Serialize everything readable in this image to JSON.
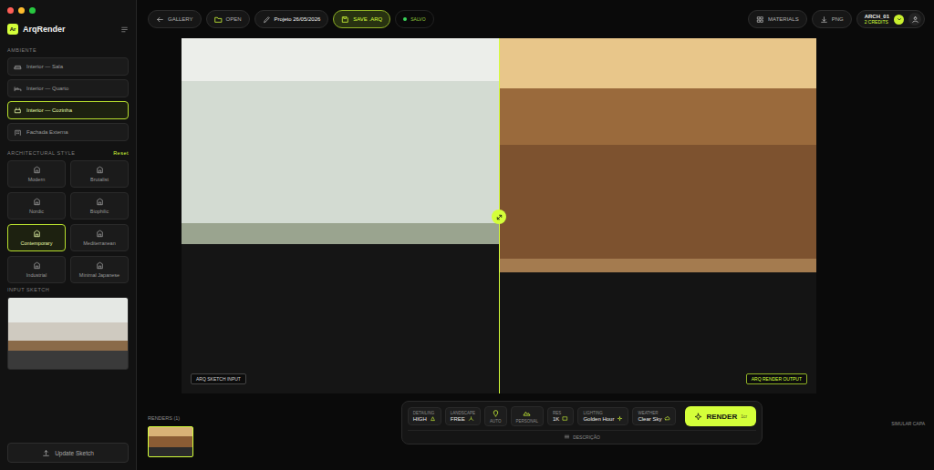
{
  "app": {
    "logo_mark": "Ar",
    "name": "ArqRender"
  },
  "sidebar": {
    "ambient_title": "AMBIENTE",
    "ambients": [
      {
        "label": "Interior — Sala",
        "selected": false
      },
      {
        "label": "Interior — Quarto",
        "selected": false
      },
      {
        "label": "Interior — Cozinha",
        "selected": true
      },
      {
        "label": "Fachada Externa",
        "selected": false
      }
    ],
    "style_title": "ARCHITECTURAL STYLE",
    "style_reset": "Reset",
    "styles": [
      {
        "label": "Modern",
        "selected": false
      },
      {
        "label": "Brutalist",
        "selected": false
      },
      {
        "label": "Nordic",
        "selected": false
      },
      {
        "label": "Biophilic",
        "selected": false
      },
      {
        "label": "Contemporary",
        "selected": true
      },
      {
        "label": "Mediterranean",
        "selected": false
      },
      {
        "label": "Industrial",
        "selected": false
      },
      {
        "label": "Minimal Japanese",
        "selected": false
      }
    ],
    "sketch_title": "INPUT SKETCH",
    "update_button": "Update Sketch"
  },
  "topbar": {
    "gallery": "GALLERY",
    "open": "OPEN",
    "project": "Projeto 26/05/2026",
    "save": "SAVE .ARQ",
    "status": "SALVO",
    "materials": "MATERIALS",
    "export": "PNG",
    "user": "ARCH_01",
    "credits": "2 CREDITS"
  },
  "canvas": {
    "split": 0.5,
    "input_label": "ARQ SKETCH INPUT",
    "output_label": "ARQ RENDER OUTPUT"
  },
  "renders": {
    "title": "RENDERS (1)",
    "items": [
      {
        "selected": true
      }
    ]
  },
  "controls": [
    {
      "kind": "field",
      "label": "DETAILING",
      "value": "HIGH"
    },
    {
      "kind": "field",
      "label": "LANDSCAPE",
      "value": "FREE"
    },
    {
      "kind": "icon",
      "label": "",
      "value": "AUTO"
    },
    {
      "kind": "icon",
      "label": "",
      "value": "PERSONAL"
    },
    {
      "kind": "field",
      "label": "RES",
      "value": "1K"
    },
    {
      "kind": "field",
      "label": "LIGHTING",
      "value": "Golden Hour"
    },
    {
      "kind": "field",
      "label": "WEATHER",
      "value": "Clear Sky"
    }
  ],
  "render_button": {
    "label": "RENDER",
    "cost": "1cr"
  },
  "description": "DESCRIÇÃO",
  "hint": "SIMULAR CAPA"
}
